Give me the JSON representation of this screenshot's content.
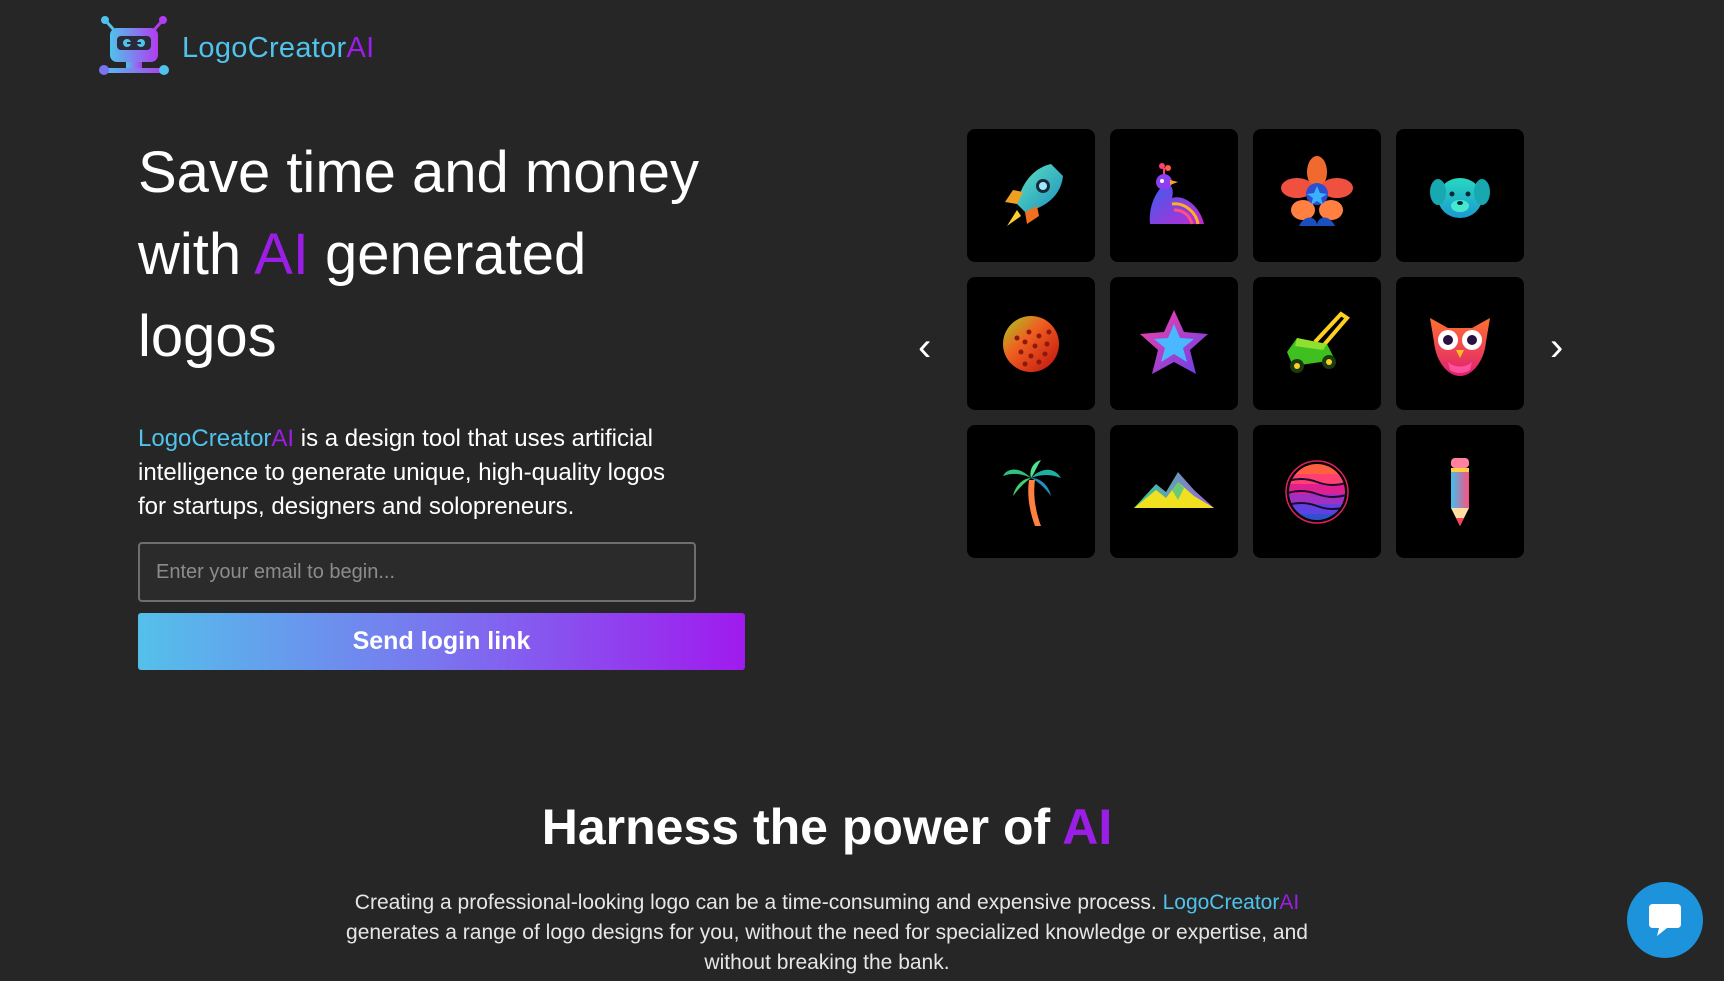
{
  "header": {
    "brand_part1": "LogoCreator",
    "brand_part2": "AI"
  },
  "hero": {
    "title_line1": "Save time and money",
    "title_with": "with",
    "title_ai": "AI",
    "title_generated": "generated",
    "title_line3": "logos",
    "desc_brand1": "LogoCreator",
    "desc_brand2": "AI",
    "desc_text": " is a design tool that uses artificial intelligence to generate unique, high-quality logos for startups, designers and solopreneurs."
  },
  "email": {
    "placeholder": "Enter your email to begin..."
  },
  "send_button": {
    "label": "Send login link"
  },
  "carousel": {
    "prev_glyph": "‹",
    "next_glyph": "›",
    "tiles": [
      {
        "icon": "rocket-icon"
      },
      {
        "icon": "peacock-icon"
      },
      {
        "icon": "flower-icon"
      },
      {
        "icon": "puppy-icon"
      },
      {
        "icon": "golf-ball-icon"
      },
      {
        "icon": "star-icon"
      },
      {
        "icon": "lawn-mower-icon"
      },
      {
        "icon": "owl-icon"
      },
      {
        "icon": "palm-tree-icon"
      },
      {
        "icon": "mountain-icon"
      },
      {
        "icon": "sunset-circle-icon"
      },
      {
        "icon": "pencil-icon"
      }
    ]
  },
  "section": {
    "title_main": "Harness the power of ",
    "title_ai": "AI",
    "text_part1": "Creating a professional-looking logo can be a time-consuming and expensive process. ",
    "brand1": "LogoCreator",
    "brand2": "AI",
    "text_part2": " generates a range of logo designs for you, without the need for specialized knowledge or expertise, and without breaking the bank."
  },
  "chat": {
    "icon": "chat-bubble-icon"
  },
  "colors": {
    "background": "#262626",
    "accent_blue": "#4fc3ec",
    "accent_purple": "#9b1ee6",
    "chat_blue": "#1c93db"
  }
}
